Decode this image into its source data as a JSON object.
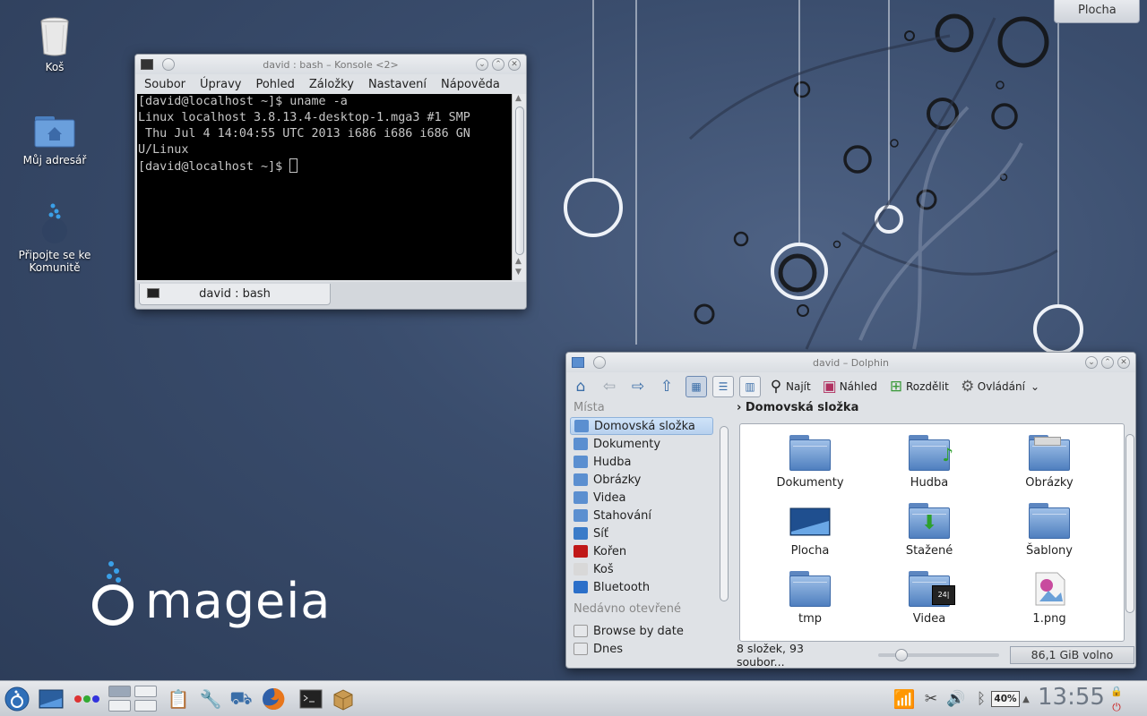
{
  "desktop": {
    "icons": [
      {
        "label": "Koš"
      },
      {
        "label": "Můj adresář"
      },
      {
        "label": "Připojte se ke Komunitě"
      }
    ],
    "activity_tab": "Plocha",
    "logo_text": "mageia"
  },
  "konsole": {
    "title": "david : bash – Konsole <2>",
    "menu": [
      "Soubor",
      "Úpravy",
      "Pohled",
      "Záložky",
      "Nastavení",
      "Nápověda"
    ],
    "terminal_lines": [
      "[david@localhost ~]$ uname -a",
      "Linux localhost 3.8.13.4-desktop-1.mga3 #1 SMP",
      " Thu Jul 4 14:04:55 UTC 2013 i686 i686 i686 GN",
      "U/Linux",
      "[david@localhost ~]$ "
    ],
    "tab_label": "david : bash"
  },
  "dolphin": {
    "title": "david – Dolphin",
    "toolbar": {
      "find": "Najít",
      "preview": "Náhled",
      "split": "Rozdělit",
      "control": "Ovládání"
    },
    "places_header": "Místa",
    "places": [
      {
        "label": "Domovská složka",
        "color": "#5b8fd0"
      },
      {
        "label": "Dokumenty",
        "color": "#5b8fd0"
      },
      {
        "label": "Hudba",
        "color": "#5b8fd0"
      },
      {
        "label": "Obrázky",
        "color": "#5b8fd0"
      },
      {
        "label": "Videa",
        "color": "#5b8fd0"
      },
      {
        "label": "Stahování",
        "color": "#5b8fd0"
      },
      {
        "label": "Síť",
        "color": "#3a7bc8"
      },
      {
        "label": "Kořen",
        "color": "#c01818"
      },
      {
        "label": "Koš",
        "color": "#d8d8d8"
      },
      {
        "label": "Bluetooth",
        "color": "#2b6fc9"
      }
    ],
    "recent_header": "Nedávno otevřené",
    "recent": [
      {
        "label": "Browse by date"
      },
      {
        "label": "Dnes"
      }
    ],
    "breadcrumb": "Domovská složka",
    "files": [
      {
        "name": "Dokumenty",
        "icon": "folder-documents-icon"
      },
      {
        "name": "Hudba",
        "icon": "folder-music-icon"
      },
      {
        "name": "Obrázky",
        "icon": "folder-images-icon"
      },
      {
        "name": "Plocha",
        "icon": "desktop-icon"
      },
      {
        "name": "Stažené",
        "icon": "folder-downloads-icon"
      },
      {
        "name": "Šablony",
        "icon": "folder-templates-icon"
      },
      {
        "name": "tmp",
        "icon": "folder-icon"
      },
      {
        "name": "Videa",
        "icon": "folder-video-icon"
      },
      {
        "name": "1.png",
        "icon": "image-file-icon"
      }
    ],
    "status_text": "8 složek, 93 soubor...",
    "zoom": 0.15,
    "free_space": "86,1 GiB volno"
  },
  "panel": {
    "battery": "40%",
    "clock": "13:55"
  }
}
